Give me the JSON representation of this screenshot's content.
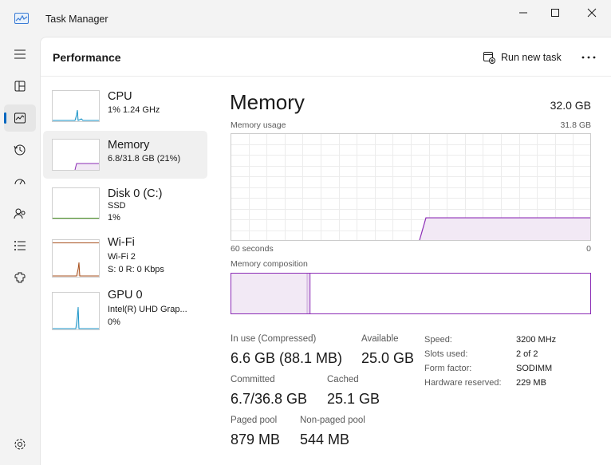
{
  "window": {
    "title": "Task Manager",
    "icon": "performance-chart-icon"
  },
  "nav": {
    "items": [
      {
        "name": "hamburger-menu-icon"
      },
      {
        "name": "processes-icon"
      },
      {
        "name": "performance-icon",
        "active": true
      },
      {
        "name": "app-history-icon"
      },
      {
        "name": "startup-apps-icon"
      },
      {
        "name": "users-icon"
      },
      {
        "name": "details-icon"
      },
      {
        "name": "services-icon"
      },
      {
        "name": "settings-icon"
      }
    ]
  },
  "header": {
    "title": "Performance",
    "run_new_task": "Run new task",
    "more": "more-options-icon"
  },
  "devices": [
    {
      "name": "CPU",
      "line1": "1%  1.24 GHz",
      "line2": "",
      "color": "#1893c7",
      "selected": false
    },
    {
      "name": "Memory",
      "line1": "6.8/31.8 GB (21%)",
      "line2": "",
      "color": "#8b2bb5",
      "selected": true
    },
    {
      "name": "Disk 0 (C:)",
      "line1": "SSD",
      "line2": "1%",
      "color": "#4f9a2a",
      "selected": false
    },
    {
      "name": "Wi-Fi",
      "line1": "Wi-Fi 2",
      "line2": "S: 0  R: 0 Kbps",
      "color": "#a74f1c",
      "selected": false
    },
    {
      "name": "GPU 0",
      "line1": "Intel(R) UHD Grap...",
      "line2": "0%",
      "color": "#1893c7",
      "selected": false
    }
  ],
  "memory": {
    "title": "Memory",
    "total": "32.0 GB",
    "usage_label": "Memory usage",
    "usage_max": "31.8 GB",
    "time_left": "60 seconds",
    "time_right": "0",
    "composition_label": "Memory composition",
    "accent": "#8b2bb5",
    "fill": "#f2e9f5",
    "usage_fraction": 0.21,
    "in_use_fraction": 0.21,
    "modified_fraction": 0.006
  },
  "stats": {
    "in_use_label": "In use (Compressed)",
    "in_use_value": "6.6 GB (88.1 MB)",
    "available_label": "Available",
    "available_value": "25.0 GB",
    "committed_label": "Committed",
    "committed_value": "6.7/36.8 GB",
    "cached_label": "Cached",
    "cached_value": "25.1 GB",
    "paged_label": "Paged pool",
    "paged_value": "879 MB",
    "nonpaged_label": "Non-paged pool",
    "nonpaged_value": "544 MB"
  },
  "specs": {
    "speed_label": "Speed:",
    "speed_value": "3200 MHz",
    "slots_label": "Slots used:",
    "slots_value": "2 of 2",
    "form_label": "Form factor:",
    "form_value": "SODIMM",
    "reserved_label": "Hardware reserved:",
    "reserved_value": "229 MB"
  }
}
